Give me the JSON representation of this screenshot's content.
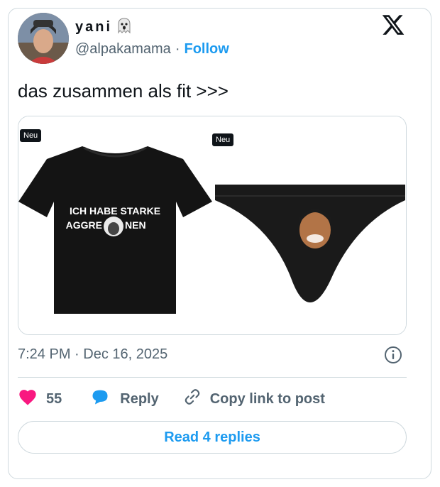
{
  "author": {
    "display_name": "yani",
    "emoji": "ghost-emoji",
    "handle": "@alpakamama",
    "separator": "·",
    "follow_label": "Follow"
  },
  "tweet": {
    "text": "das zusammen als fit >>>",
    "timestamp": "7:24 PM · Dec 16, 2025"
  },
  "media": {
    "left": {
      "badge": "Neu",
      "shirt_text_line1": "ICH HABE STARKE",
      "shirt_text_line2_a": "AGGRE",
      "shirt_text_line2_b": "NEN"
    },
    "right": {
      "badge": "Neu"
    }
  },
  "actions": {
    "like_count": "55",
    "reply_label": "Reply",
    "copy_label": "Copy link to post"
  },
  "read_replies_label": "Read 4 replies",
  "colors": {
    "accent": "#1d9bf0",
    "like": "#f91880",
    "text_secondary": "#536471",
    "border": "#cfd9de"
  },
  "icons": [
    "x-logo-icon",
    "info-icon",
    "heart-icon",
    "reply-bubble-icon",
    "link-icon"
  ]
}
